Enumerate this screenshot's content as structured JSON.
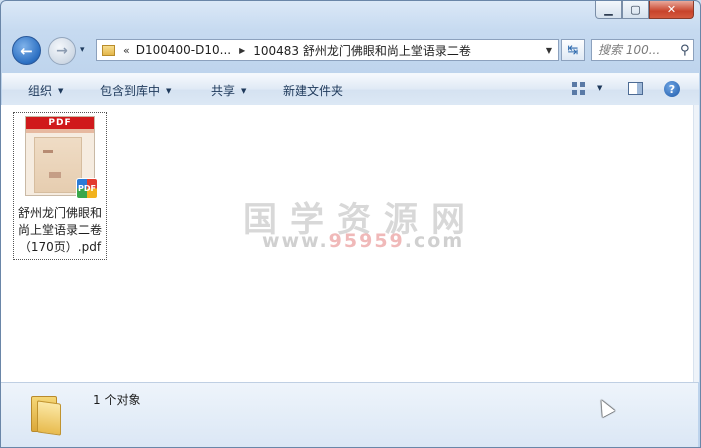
{
  "window": {
    "minimize_symbol": "▁",
    "maximize_symbol": "▢",
    "close_symbol": "✕"
  },
  "nav": {
    "back_symbol": "←",
    "forward_symbol": "→",
    "history_dropdown_symbol": "▾"
  },
  "address": {
    "overflow_chevron": "«",
    "segments": [
      "D100400-D10...",
      "100483 舒州龙门佛眼和尚上堂语录二卷"
    ],
    "separator": "▶",
    "dropdown_symbol": "▼"
  },
  "refresh_symbol": "↹",
  "search": {
    "placeholder": "搜索 100...",
    "icon_symbol": "⚲"
  },
  "toolbar": {
    "organize_label": "组织",
    "include_in_library_label": "包含到库中",
    "share_label": "共享",
    "new_folder_label": "新建文件夹",
    "dropdown_arrow": "▼",
    "help_symbol": "?"
  },
  "files": [
    {
      "name": "舒州龙门佛眼和尚上堂语录二卷（170页）.pdf",
      "thumb_band_text": "PDF",
      "badge_text": "PDF"
    }
  ],
  "watermark": {
    "title": "国学资源网",
    "url_prefix": "www.",
    "url_accent": "95959",
    "url_suffix": ".com"
  },
  "status": {
    "item_count": "1 个对象"
  },
  "colors": {
    "accent": "#2b6fc2",
    "close_button": "#c8432b",
    "pdf_band": "#d0191b"
  }
}
